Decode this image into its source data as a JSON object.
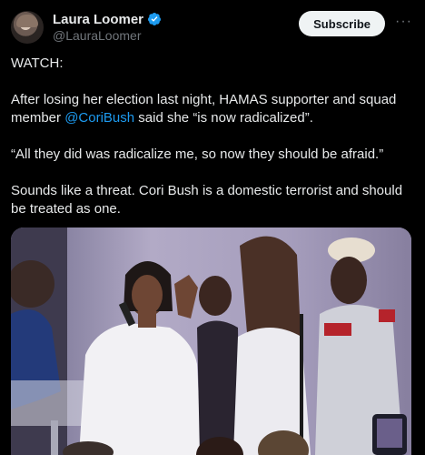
{
  "author": {
    "name": "Laura Loomer",
    "handle": "@LauraLoomer",
    "verified": true
  },
  "actions": {
    "subscribe_label": "Subscribe",
    "more_label": "···"
  },
  "post": {
    "line1": "WATCH:",
    "para2_before": "After losing her election last night, HAMAS supporter and squad member ",
    "para2_mention": "@CoriBush",
    "para2_after": " said she “is now radicalized”.",
    "para3": "“All they did was radicalize me, so now they should be afraid.”",
    "para4": "Sounds like a threat. Cori Bush is a domestic terrorist and should be treated as one."
  },
  "media": {
    "description_icon": "video-thumbnail"
  },
  "colors": {
    "background": "#000000",
    "text": "#e7e9ea",
    "muted": "#71767b",
    "link": "#1d9bf0",
    "verified": "#1d9bf0",
    "subscribe_bg": "#eff3f4"
  }
}
